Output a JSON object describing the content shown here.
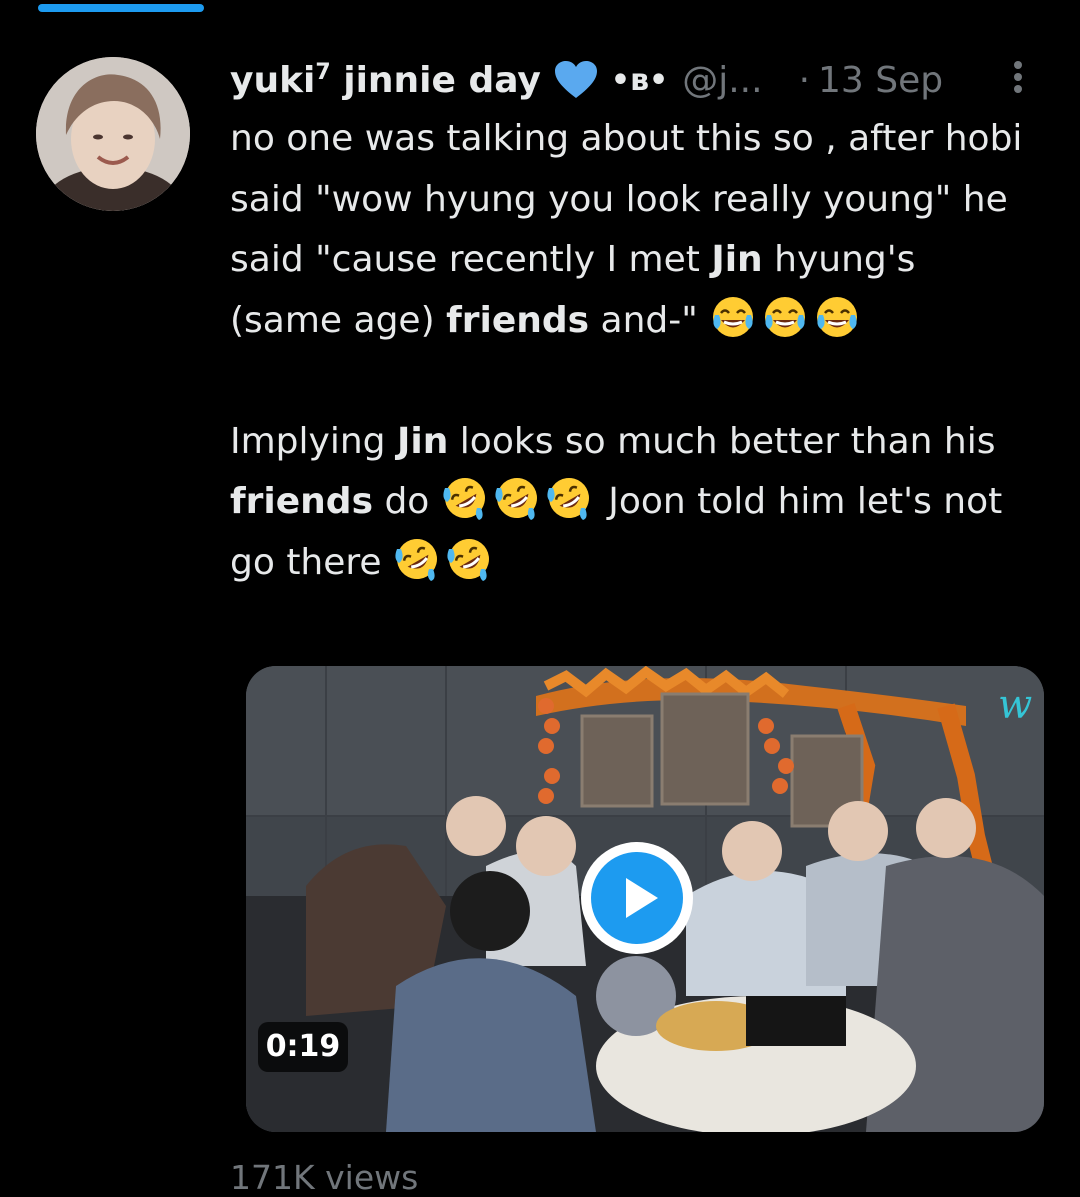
{
  "tweet": {
    "display_name": "yuki",
    "display_name_sup": "7",
    "display_name_rest": " jinnie day",
    "handle_deco": "•ʙ•",
    "handle": "@j...",
    "dot": "·",
    "timestamp": "13 Sep",
    "text": {
      "p1_a": "no one was talking about this so , after hobi said \"wow hyung you look really young\" he said \"cause recently I met ",
      "p1_b": "Jin",
      "p1_c": " hyung's (same age) ",
      "p1_d": "friends",
      "p1_e": " and-\" ",
      "p2_a": "Implying ",
      "p2_b": "Jin",
      "p2_c": " looks so much better than his ",
      "p2_d": "friends",
      "p2_e": " do ",
      "p2_f": " Joon told him let's not go there "
    },
    "media": {
      "duration": "0:19",
      "watermark": "w"
    },
    "views": "171K views"
  },
  "colors": {
    "background": "#000000",
    "text_primary": "#e7e9ea",
    "text_secondary": "#71767b",
    "accent": "#1d9bf0"
  },
  "icons": {
    "heart": "blue-heart-icon",
    "more": "more-vertical-icon",
    "play": "play-icon",
    "emoji_tears": "face-with-tears-of-joy-icon",
    "emoji_rofl": "rolling-on-floor-laughing-icon"
  },
  "progress": {
    "value": 0.15
  }
}
